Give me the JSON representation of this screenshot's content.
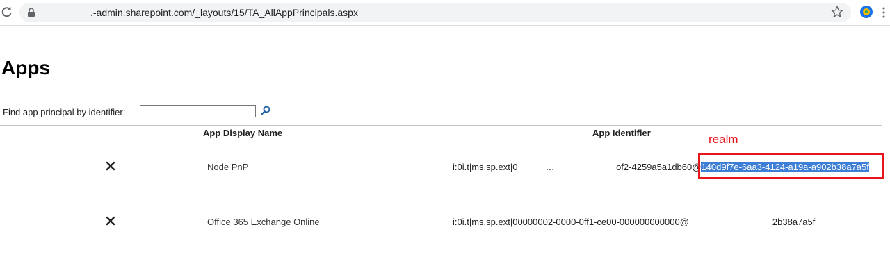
{
  "browser": {
    "url_prefix": "",
    "url_domain": ".-admin.sharepoint.com/",
    "url_path": "_layouts/15/TA_AllAppPrincipals.aspx"
  },
  "page": {
    "title": "Apps",
    "find_label": "Find app principal by identifier:",
    "find_value": ""
  },
  "table": {
    "headers": {
      "display_name": "App Display Name",
      "identifier": "App Identifier"
    },
    "rows": [
      {
        "name": "Node PnP",
        "id_part1": "i:0i.t|ms.sp.ext|0",
        "id_part2": "… ",
        "id_part3": "of2-4259a5a1db60@",
        "id_realm": "140d9f7e-6aa3-4124-a19a-a902b38a7a5f"
      },
      {
        "name": "Office 365 Exchange Online",
        "id_part1": "i:0i.t|ms.sp.ext|00000002-0000-0ff1-ce00-000000000000@",
        "id_part2": "",
        "id_part3": "2b38a7a5f"
      }
    ]
  },
  "annotation": {
    "label": "realm",
    "color": "#e8141c"
  },
  "colors": {
    "highlight": "#3d7ed6",
    "omnibox": "#f1f3f4"
  }
}
